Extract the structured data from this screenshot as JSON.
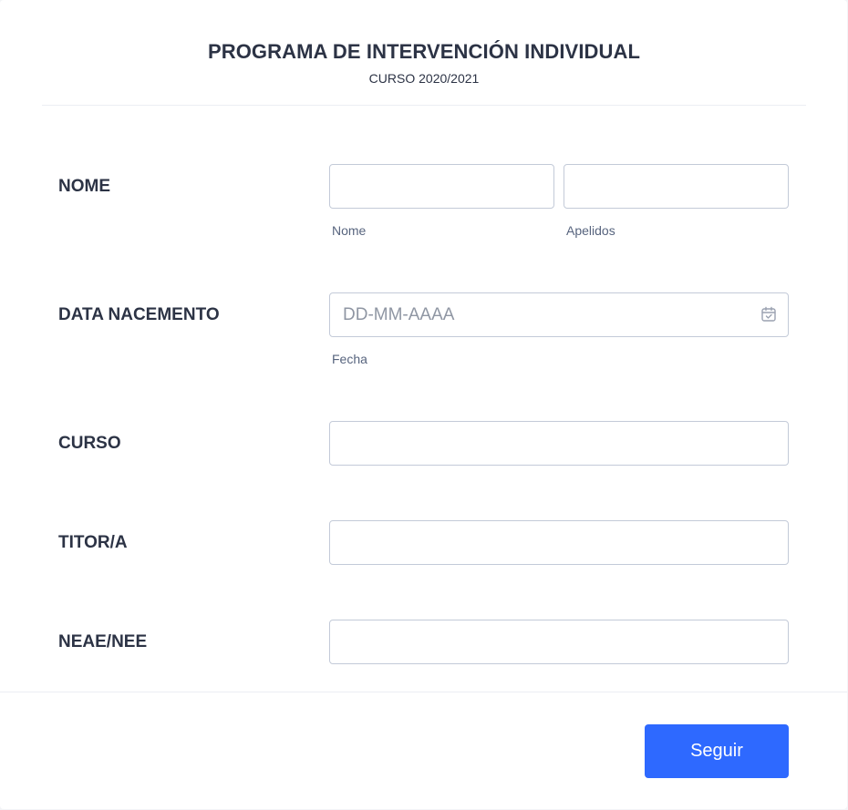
{
  "header": {
    "title": "PROGRAMA DE INTERVENCIÓN INDIVIDUAL",
    "subtitle": "CURSO 2020/2021"
  },
  "fields": {
    "nome": {
      "label": "NOME",
      "first_value": "",
      "first_sublabel": "Nome",
      "last_value": "",
      "last_sublabel": "Apelidos"
    },
    "birthdate": {
      "label": "DATA NACEMENTO",
      "placeholder": "DD-MM-AAAA",
      "value": "",
      "sublabel": "Fecha",
      "icon": "calendar-check-icon"
    },
    "curso": {
      "label": "CURSO",
      "value": ""
    },
    "titor": {
      "label": "TITOR/A",
      "value": ""
    },
    "neae": {
      "label": "NEAE/NEE",
      "value": ""
    }
  },
  "footer": {
    "next_label": "Seguir"
  },
  "colors": {
    "accent": "#2e69ff",
    "text": "#2c3345",
    "border": "#c3cad8",
    "sublabel": "#57647e"
  }
}
